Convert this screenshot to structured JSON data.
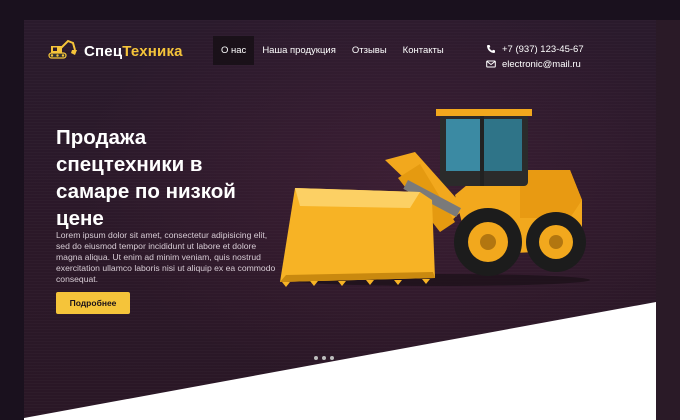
{
  "header": {
    "logo_part1": "Спец",
    "logo_part2": "Техника",
    "nav": [
      {
        "label": "О нас",
        "active": true
      },
      {
        "label": "Наша продукция",
        "active": false
      },
      {
        "label": "Отзывы",
        "active": false
      },
      {
        "label": "Контакты",
        "active": false
      }
    ],
    "phone": "+7 (937) 123-45-67",
    "email": "electronic@mail.ru"
  },
  "hero": {
    "title": "Продажа спецтехники в самаре по низкой цене",
    "description": "Lorem ipsum dolor sit amet, consectetur adipisicing elit, sed do eiusmod tempor incididunt ut labore et dolore magna aliqua. Ut enim ad minim veniam, quis nostrud exercitation ullamco laboris nisi ut aliquip ex ea commodo consequat.",
    "button_label": "Подробнее"
  },
  "colors": {
    "accent": "#f5c43a",
    "background": "#2a1a2c",
    "text": "#ffffff"
  },
  "icons": {
    "logo": "excavator-icon",
    "phone": "phone-icon",
    "email": "envelope-icon",
    "hero_image": "wheel-loader-illustration"
  }
}
